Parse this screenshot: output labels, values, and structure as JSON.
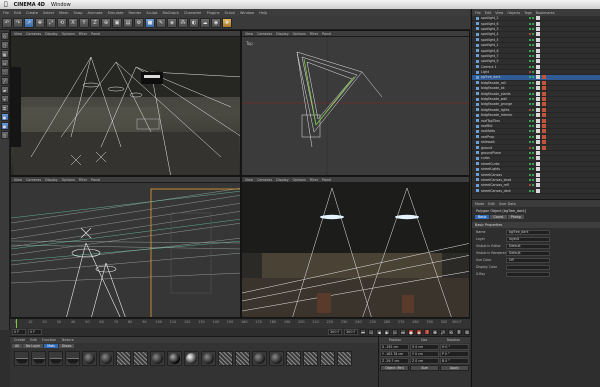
{
  "mac_menu": {
    "app_name": "CINEMA 4D",
    "window_menu": "Window"
  },
  "menubar": {
    "items": [
      "File",
      "Edit",
      "Create",
      "Select",
      "Mesh",
      "Snap",
      "Animate",
      "Simulate",
      "Render",
      "Sculpt",
      "MoGraph",
      "Character",
      "Plugins",
      "Script",
      "Window",
      "Help"
    ]
  },
  "viewports": [
    {
      "menu": [
        "View",
        "Cameras",
        "Display",
        "Options",
        "Filter",
        "Panel"
      ],
      "label": ""
    },
    {
      "menu": [
        "View",
        "Cameras",
        "Display",
        "Options",
        "Filter",
        "Panel"
      ],
      "label": "Top"
    },
    {
      "menu": [
        "View",
        "Cameras",
        "Display",
        "Options",
        "Filter",
        "Panel"
      ],
      "label": ""
    },
    {
      "menu": [
        "View",
        "Cameras",
        "Display",
        "Options",
        "Filter",
        "Panel"
      ],
      "label": ""
    }
  ],
  "timeline": {
    "ticks": [
      "0",
      "10",
      "20",
      "30",
      "40",
      "50",
      "60",
      "70",
      "80",
      "90",
      "100",
      "110",
      "120",
      "130",
      "140",
      "150",
      "160",
      "170",
      "180",
      "190",
      "200",
      "210",
      "220",
      "230",
      "240",
      "250",
      "260",
      "270",
      "280",
      "290",
      "300"
    ],
    "end_frame": "300 F"
  },
  "transport": {
    "current_frame": "0 F",
    "start_frame": "0 F",
    "end_field": "300 F",
    "end_field_2": "300 F"
  },
  "material_manager": {
    "menu": [
      "Create",
      "Edit",
      "Function",
      "Texture"
    ],
    "tabs": [
      "All",
      "No Layer",
      "Mats",
      "Glows"
    ],
    "active_tab": "Mats"
  },
  "coordinates": {
    "headers": [
      "Position",
      "Size",
      "Rotation"
    ],
    "rows": [
      {
        "axis": "X",
        "pos": "-192 cm",
        "size": "X  0 cm",
        "rot": "H  0 °"
      },
      {
        "axis": "Y",
        "pos": "-163.78 cm",
        "size": "Y  0 cm",
        "rot": "P  0 °"
      },
      {
        "axis": "Z",
        "pos": "-29.7 cm",
        "size": "Z  0 cm",
        "rot": "B  0 °"
      }
    ],
    "mode": "Object (Rel)",
    "size_mode": "Size",
    "apply_label": "Apply"
  },
  "object_manager": {
    "menu": [
      "File",
      "Edit",
      "View",
      "Objects",
      "Tags",
      "Bookmarks"
    ],
    "rows": [
      "spotlight_2",
      "spotlight_6",
      "spotlight_3",
      "spotlight_4",
      "spotlight_5",
      "spotlight_1",
      "spotlight_8",
      "spotlight_7",
      "spotlight_9",
      "Camera 1",
      "Light",
      "bgTree_dark",
      "bldgFacade_rail",
      "bldgFacade_bk",
      "bldgFacade_plants",
      "bldgFacade_wall",
      "bldgFacade_grunge",
      "bldgFacade_lights",
      "bldgFacade_interior",
      "roofTopTiles",
      "roofBld",
      "roofAdds",
      "roofProp",
      "sidewalk",
      "ground",
      "groundPlane",
      "curbs",
      "streetCurbs",
      "streetLights",
      "streetCanvas",
      "streetCanvas_shad",
      "streetCanvas_refl",
      "streetCanvas_dark",
      "streetCanvas_wet",
      "Sky",
      "Background"
    ],
    "selected_row": "bgTree_dark"
  },
  "attribute_manager": {
    "menu": [
      "Mode",
      "Edit",
      "User Data"
    ],
    "object_line": "Polygon Object [bgTree_dark]",
    "tabs": [
      "Basic",
      "Coord.",
      "Phong"
    ],
    "active_tab": "Basic",
    "section": "Basic Properties",
    "fields": [
      {
        "label": "Name",
        "value": "bgTree_dark"
      },
      {
        "label": "Layer",
        "value": "layerA"
      },
      {
        "label": "Visible in Editor",
        "value": "Default"
      },
      {
        "label": "Visible in Renderer",
        "value": "Default"
      },
      {
        "label": "Use Color",
        "value": "Off"
      },
      {
        "label": "Display Color",
        "value": ""
      },
      {
        "label": "X-Ray",
        "value": ""
      }
    ]
  },
  "colors": {
    "accent": "#2f6bb8",
    "selection_frame": "#e0a030",
    "axis_y": "#7ac943",
    "axis_x": "#d24a3a"
  }
}
